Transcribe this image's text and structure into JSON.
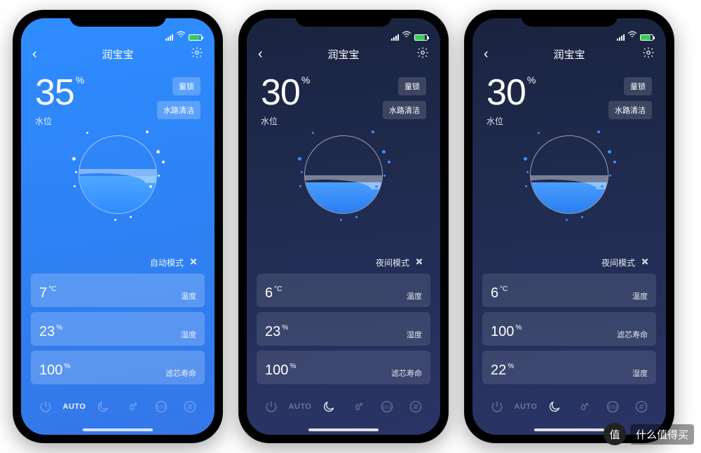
{
  "watermark": {
    "badge": "值",
    "text": "什么值得买"
  },
  "phones": [
    {
      "theme": "light",
      "title": "润宝宝",
      "chips": {
        "lock": "童锁",
        "clean": "水路清洁"
      },
      "reading": {
        "value": "35",
        "unit": "%",
        "label": "水位"
      },
      "orb_fill_pct": 48,
      "mode_label": "自动模式",
      "cards": [
        {
          "value": "7",
          "unit": "°C",
          "label": "温度"
        },
        {
          "value": "23",
          "unit": "%",
          "label": "湿度"
        },
        {
          "value": "100",
          "unit": "%",
          "label": "滤芯寿命"
        }
      ],
      "active_mode": "auto"
    },
    {
      "theme": "dark",
      "title": "润宝宝",
      "chips": {
        "lock": "童锁",
        "clean": "水路清洁"
      },
      "reading": {
        "value": "30",
        "unit": "%",
        "label": "水位"
      },
      "orb_fill_pct": 40,
      "mode_label": "夜间模式",
      "cards": [
        {
          "value": "6",
          "unit": "°C",
          "label": "温度"
        },
        {
          "value": "23",
          "unit": "%",
          "label": "湿度"
        },
        {
          "value": "100",
          "unit": "%",
          "label": "滤芯寿命"
        }
      ],
      "active_mode": "night"
    },
    {
      "theme": "dark",
      "title": "润宝宝",
      "chips": {
        "lock": "童锁",
        "clean": "水路清洁"
      },
      "reading": {
        "value": "30",
        "unit": "%",
        "label": "水位"
      },
      "orb_fill_pct": 40,
      "mode_label": "夜间模式",
      "cards": [
        {
          "value": "6",
          "unit": "°C",
          "label": "温度"
        },
        {
          "value": "100",
          "unit": "%",
          "label": "滤芯寿命"
        },
        {
          "value": "22",
          "unit": "%",
          "label": "湿度"
        }
      ],
      "active_mode": "night"
    }
  ],
  "toolbar_labels": {
    "auto": "AUTO"
  }
}
